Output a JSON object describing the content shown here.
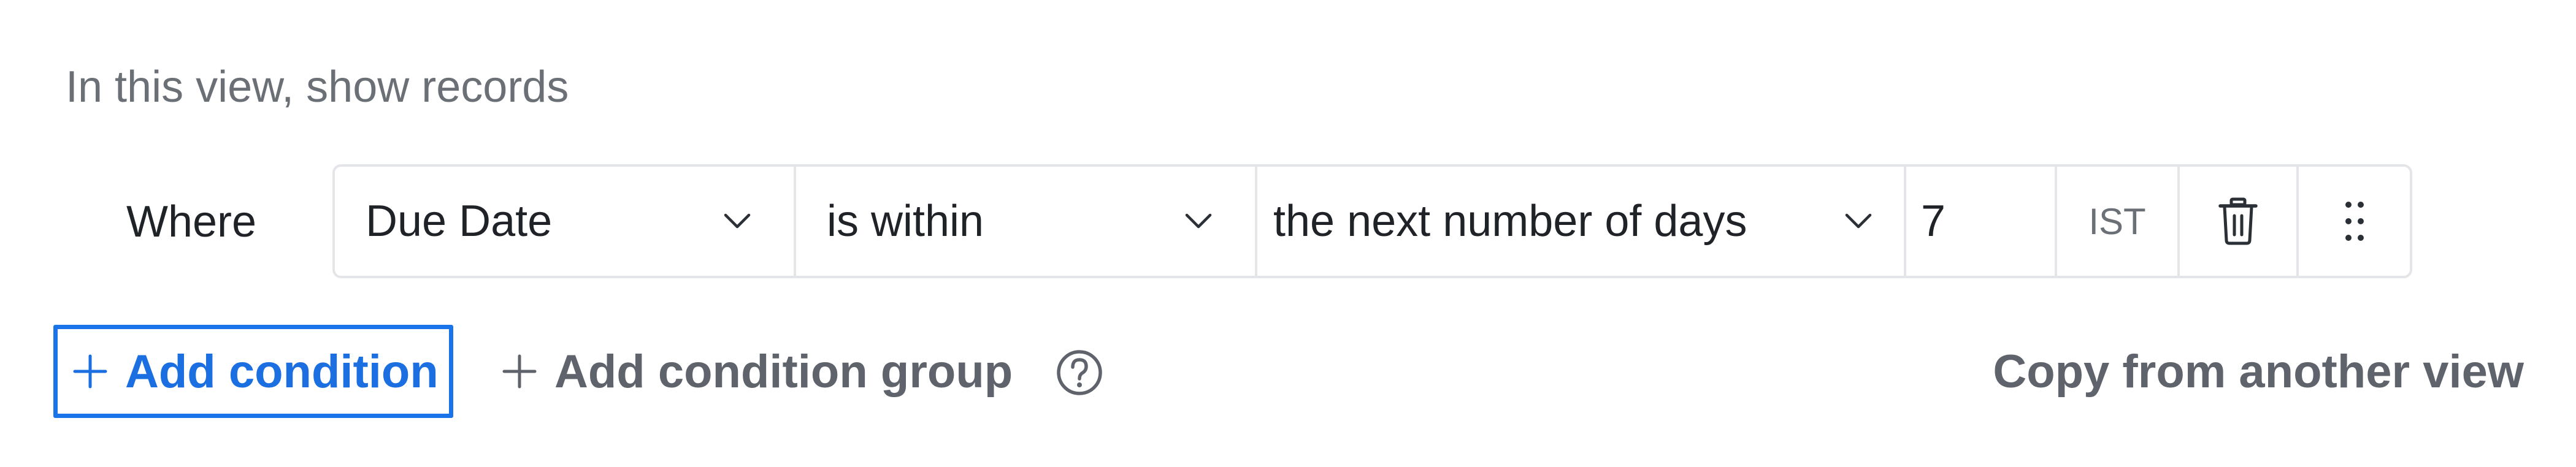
{
  "filter": {
    "heading": "In this view, show records",
    "where_label": "Where",
    "condition": {
      "field": "Due Date",
      "operator": "is within",
      "mode": "the next number of days",
      "value": "7",
      "timezone": "IST"
    },
    "add_condition_label": "Add condition",
    "add_condition_group_label": "Add condition group",
    "copy_label": "Copy from another view"
  },
  "colors": {
    "accent": "#1a73e8",
    "text_primary": "#1f2328",
    "text_secondary": "#6b6f76",
    "border": "#e4e5e8"
  },
  "icons": [
    "chevron-down-icon",
    "trash-icon",
    "drag-handle-icon",
    "plus-icon",
    "help-icon"
  ]
}
